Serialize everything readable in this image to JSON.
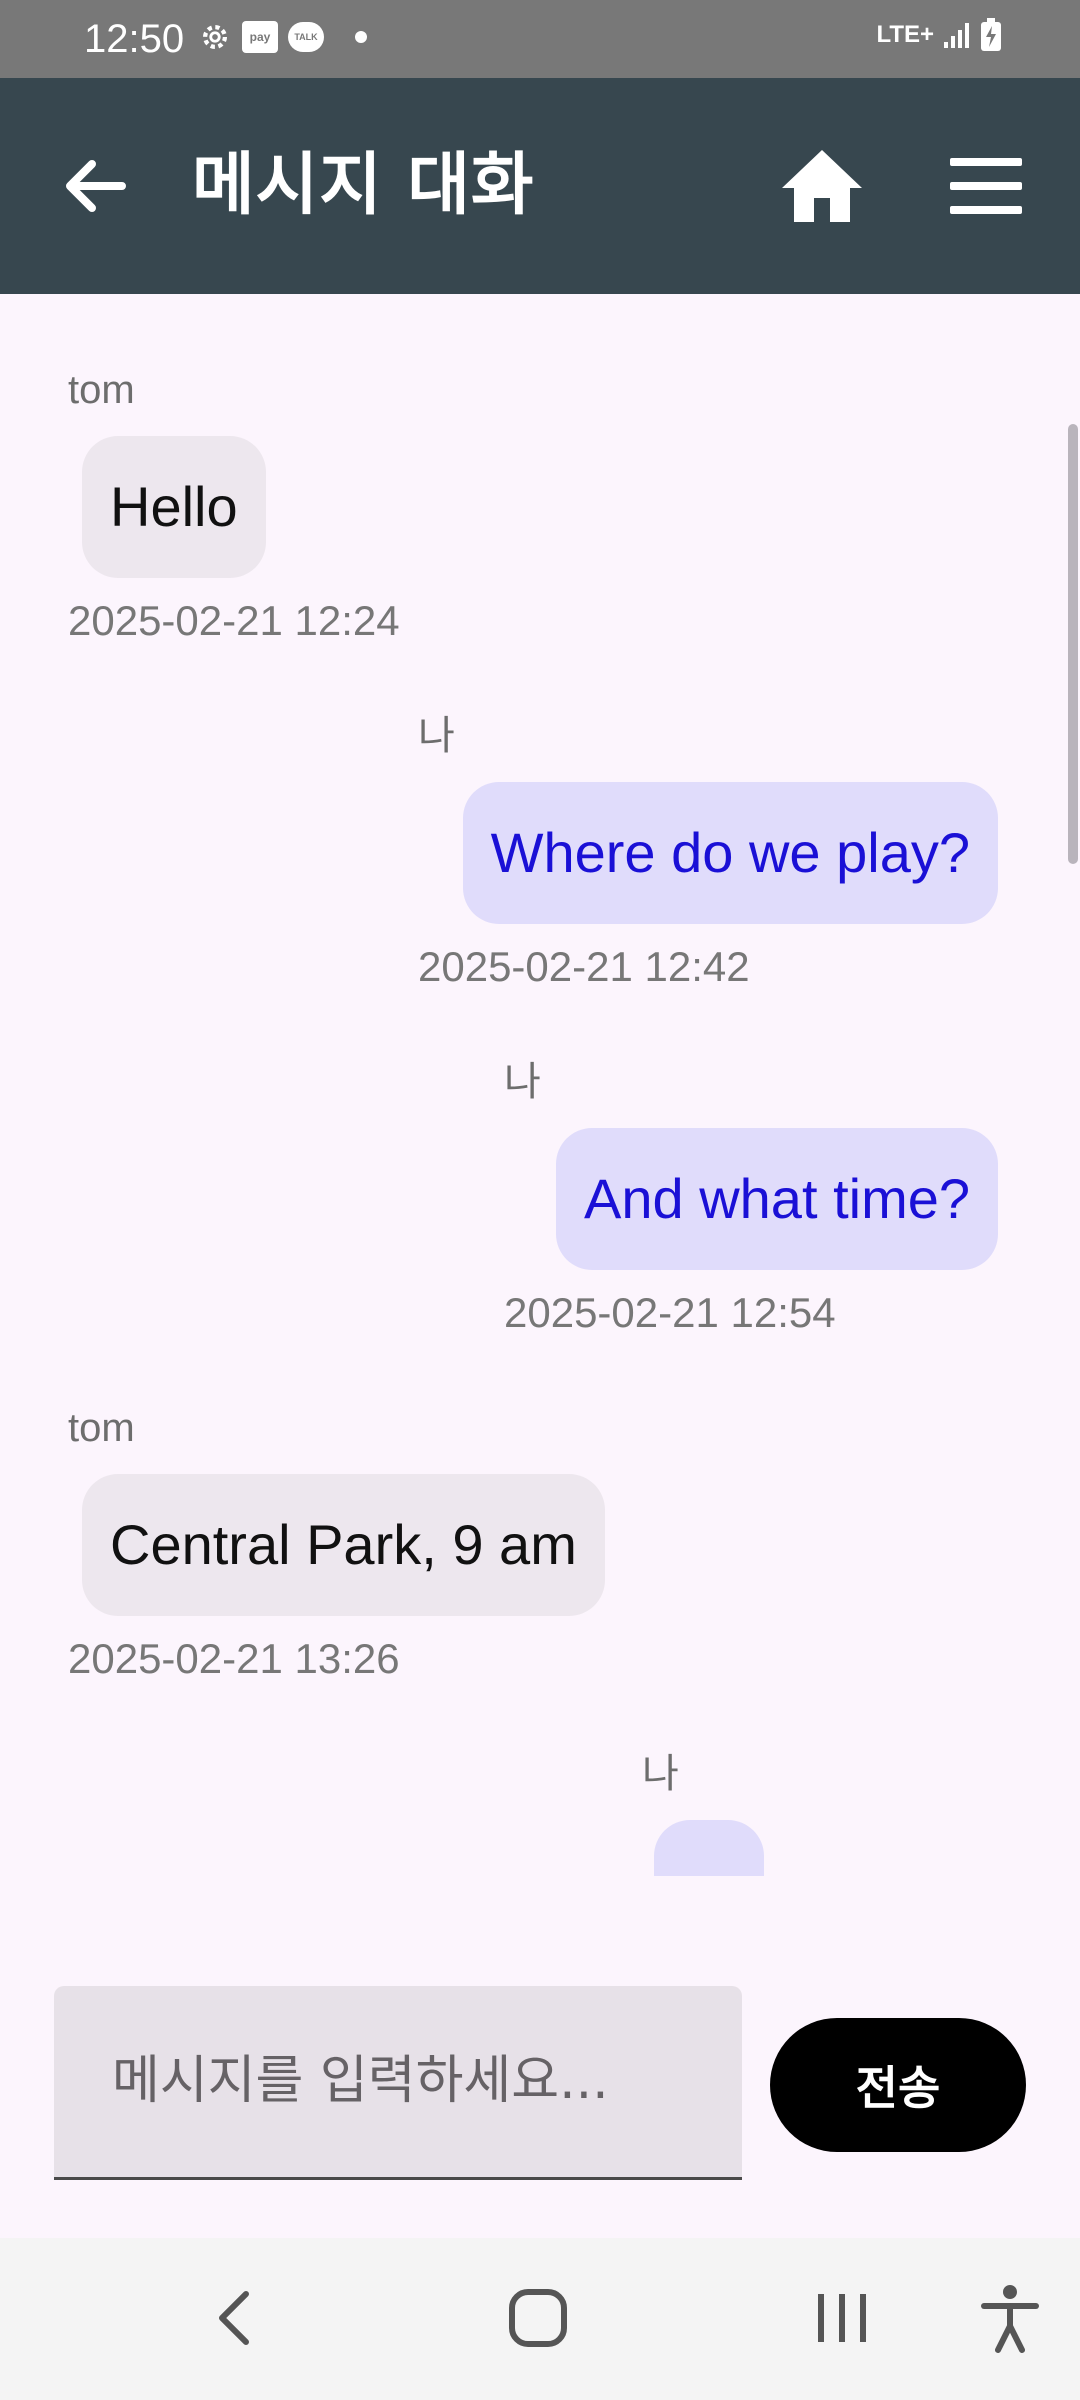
{
  "status_bar": {
    "time": "12:50",
    "left_icons": [
      "gear-icon",
      "pay-icon",
      "talk-icon",
      "dot-icon"
    ],
    "pay_label": "pay",
    "talk_label": "TALK",
    "network": "LTE+",
    "right_icons": [
      "signal-icon",
      "battery-charging-icon"
    ]
  },
  "appbar": {
    "title": "메시지 대화",
    "back_icon": "arrow-back-icon",
    "home_icon": "home-icon",
    "menu_icon": "hamburger-menu-icon",
    "background": "#37474f"
  },
  "messages": [
    {
      "sender": "tom",
      "text": "Hello",
      "timestamp": "2025-02-21 12:24",
      "direction": "incoming"
    },
    {
      "sender": "나",
      "text": "Where do we play?",
      "timestamp": "2025-02-21 12:42",
      "direction": "outgoing"
    },
    {
      "sender": "나",
      "text": "And what time?",
      "timestamp": "2025-02-21 12:54",
      "direction": "outgoing"
    },
    {
      "sender": "tom",
      "text": "Central Park, 9 am",
      "timestamp": "2025-02-21 13:26",
      "direction": "incoming"
    },
    {
      "sender": "나",
      "text": "",
      "timestamp": "",
      "direction": "outgoing"
    }
  ],
  "colors": {
    "incoming_bubble": "#ede7ee",
    "outgoing_bubble": "#e0dcfb",
    "outgoing_text": "#1a10d6",
    "background": "#fcf5fd"
  },
  "composer": {
    "placeholder": "메시지를 입력하세요...",
    "value": "",
    "send_label": "전송"
  },
  "nav_bar": {
    "icons": [
      "nav-back-icon",
      "nav-home-icon",
      "nav-recents-icon",
      "accessibility-icon"
    ]
  }
}
